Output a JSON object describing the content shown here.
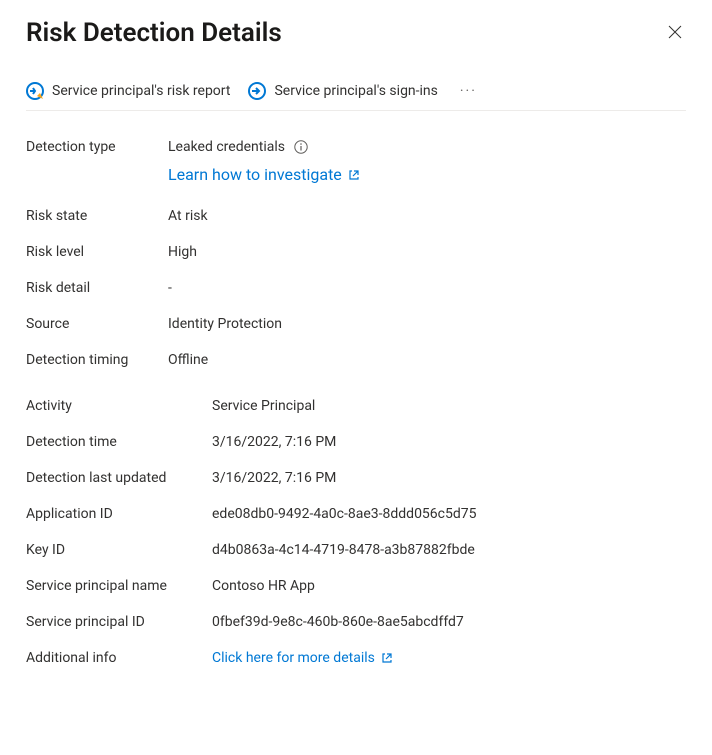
{
  "header": {
    "title": "Risk Detection Details"
  },
  "toolbar": {
    "risk_report_label": "Service principal's risk report",
    "signins_label": "Service principal's sign-ins"
  },
  "detection": {
    "type_label": "Detection type",
    "type_value": "Leaked credentials",
    "investigate_link": "Learn how to investigate",
    "state_label": "Risk state",
    "state_value": "At risk",
    "level_label": "Risk level",
    "level_value": "High",
    "detail_label": "Risk detail",
    "detail_value": "-",
    "source_label": "Source",
    "source_value": "Identity Protection",
    "timing_label": "Detection timing",
    "timing_value": "Offline",
    "activity_label": "Activity",
    "activity_value": "Service Principal",
    "time_label": "Detection time",
    "time_value": "3/16/2022, 7:16 PM",
    "updated_label": "Detection last updated",
    "updated_value": "3/16/2022, 7:16 PM",
    "app_id_label": "Application ID",
    "app_id_value": "ede08db0-9492-4a0c-8ae3-8ddd056c5d75",
    "key_id_label": "Key ID",
    "key_id_value": "d4b0863a-4c14-4719-8478-a3b87882fbde",
    "sp_name_label": "Service principal name",
    "sp_name_value": "Contoso HR App",
    "sp_id_label": "Service principal ID",
    "sp_id_value": "0fbef39d-9e8c-460b-860e-8ae5abcdffd7",
    "additional_label": "Additional info",
    "additional_link": "Click here for more details"
  }
}
